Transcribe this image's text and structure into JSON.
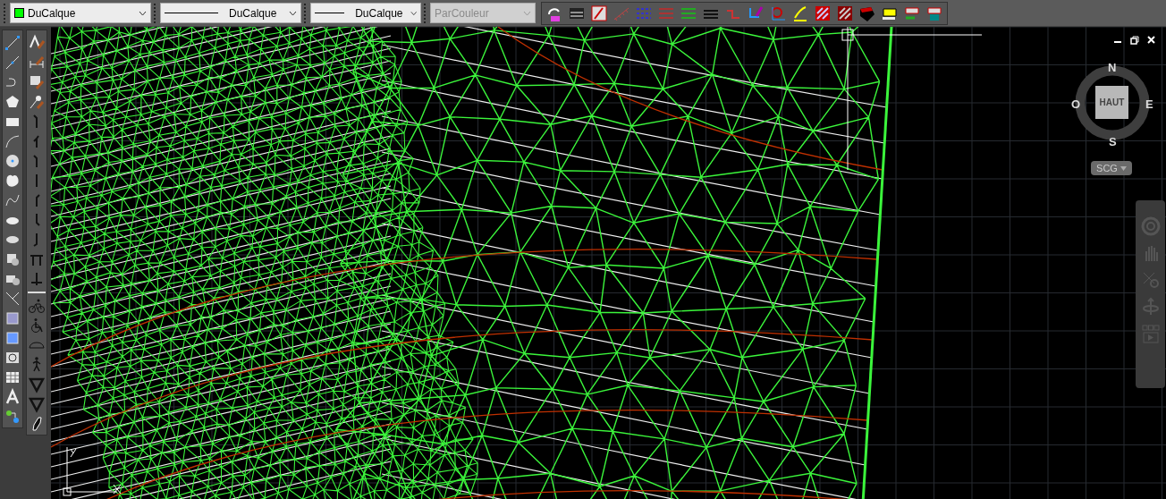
{
  "toolbar": {
    "dropdowns": [
      {
        "kind": "color",
        "value": "DuCalque",
        "color": "#00ff00",
        "disabled": false
      },
      {
        "kind": "linetype",
        "value": "DuCalque",
        "disabled": false
      },
      {
        "kind": "lineweight",
        "value": "DuCalque",
        "disabled": false
      },
      {
        "kind": "plotstyle",
        "value": "ParCouleur",
        "disabled": true
      }
    ]
  },
  "viewcube": {
    "north": "N",
    "east": "E",
    "south": "S",
    "west": "O",
    "face": "HAUT",
    "ucs_menu": "SCG"
  }
}
